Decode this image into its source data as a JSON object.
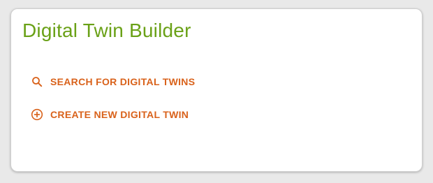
{
  "card": {
    "title": "Digital Twin Builder"
  },
  "actions": [
    {
      "label": "SEARCH FOR DIGITAL TWINS",
      "icon": "search-icon"
    },
    {
      "label": "CREATE NEW DIGITAL TWIN",
      "icon": "add-circle-icon"
    }
  ],
  "colors": {
    "title": "#6aa117",
    "accent": "#d9621b",
    "background": "#e9e9e9",
    "card": "#ffffff"
  }
}
